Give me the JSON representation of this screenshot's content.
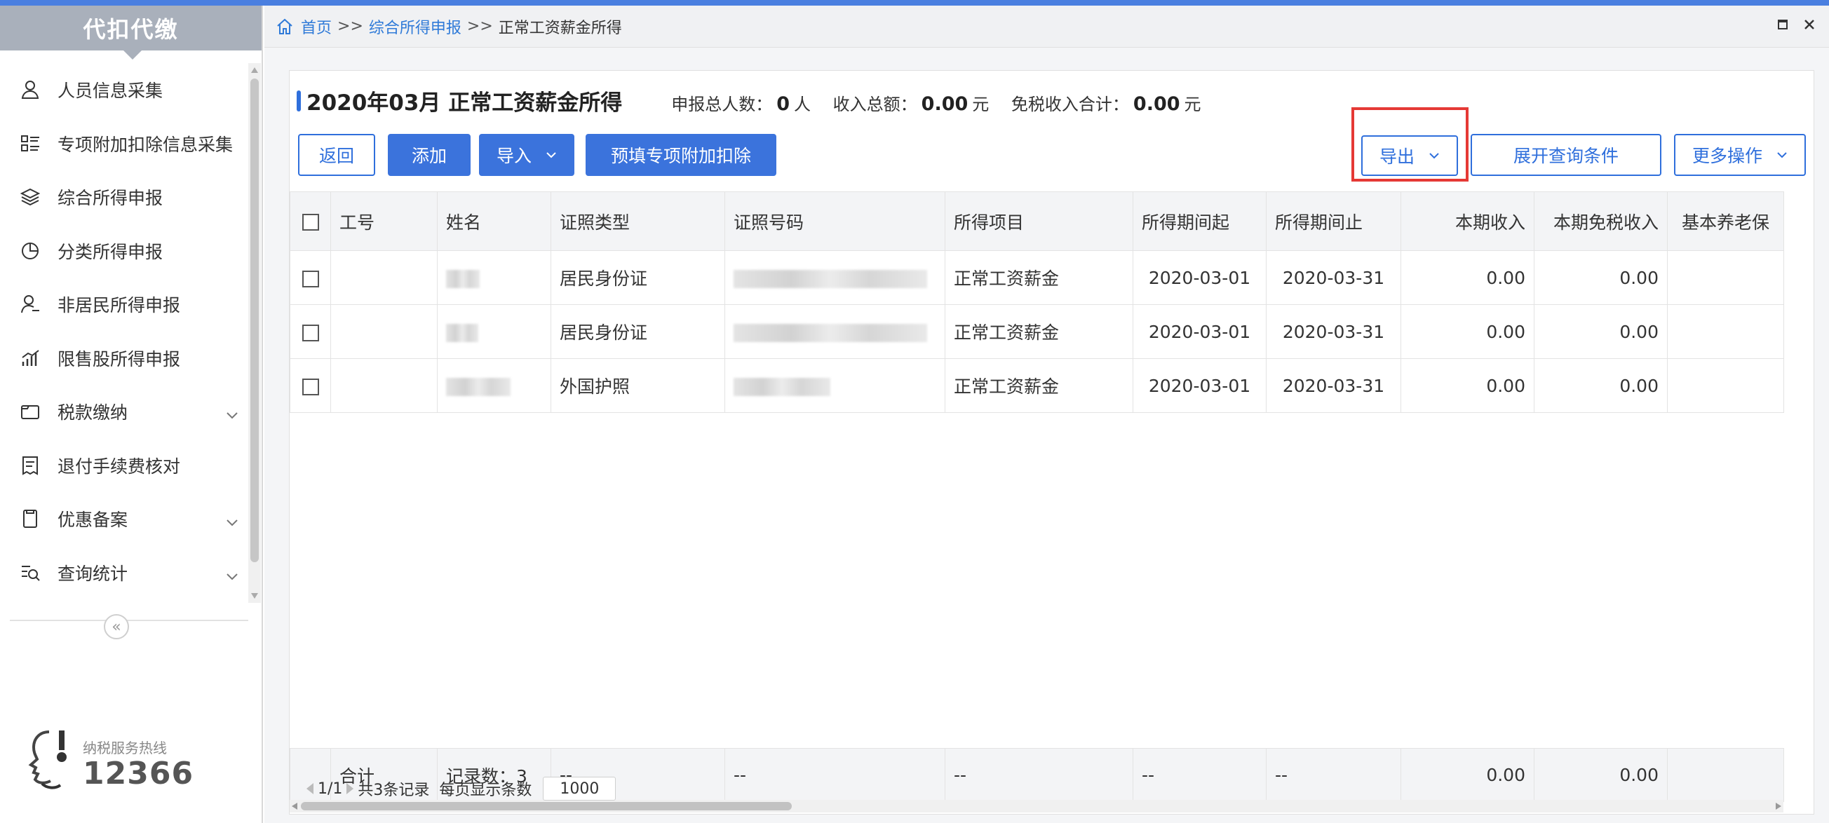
{
  "sidebar": {
    "title": "代扣代缴",
    "items": [
      {
        "label": "人员信息采集",
        "icon": "person-icon",
        "expandable": false
      },
      {
        "label": "专项附加扣除信息采集",
        "icon": "list-icon",
        "expandable": false
      },
      {
        "label": "综合所得申报",
        "icon": "layers-icon",
        "expandable": false
      },
      {
        "label": "分类所得申报",
        "icon": "pie-chart-icon",
        "expandable": false
      },
      {
        "label": "非居民所得申报",
        "icon": "person-outline-icon",
        "expandable": false
      },
      {
        "label": "限售股所得申报",
        "icon": "bar-chart-icon",
        "expandable": false
      },
      {
        "label": "税款缴纳",
        "icon": "wallet-icon",
        "expandable": true
      },
      {
        "label": "退付手续费核对",
        "icon": "receipt-icon",
        "expandable": false
      },
      {
        "label": "优惠备案",
        "icon": "document-icon",
        "expandable": true
      },
      {
        "label": "查询统计",
        "icon": "search-list-icon",
        "expandable": true
      }
    ],
    "collapse_label": "«",
    "hotline_label": "纳税服务热线",
    "hotline_number": "12366"
  },
  "breadcrumb": {
    "home": "首页",
    "sep": ">>",
    "level1": "综合所得申报",
    "current": "正常工资薪金所得"
  },
  "panel": {
    "title": "2020年03月 正常工资薪金所得",
    "summary": {
      "people_label": "申报总人数：",
      "people_value": "0",
      "people_unit": "人",
      "income_label": "收入总额：",
      "income_value": "0.00",
      "income_unit": "元",
      "taxfree_label": "免税收入合计：",
      "taxfree_value": "0.00",
      "taxfree_unit": "元"
    }
  },
  "toolbar": {
    "back": "返回",
    "add": "添加",
    "import": "导入",
    "prefill": "预填专项附加扣除",
    "export": "导出",
    "expand_query": "展开查询条件",
    "more": "更多操作"
  },
  "table": {
    "headers": [
      "工号",
      "姓名",
      "证照类型",
      "证照号码",
      "所得项目",
      "所得期间起",
      "所得期间止",
      "本期收入",
      "本期免税收入",
      "基本养老保"
    ],
    "rows": [
      {
        "emp_id": "",
        "id_type": "居民身份证",
        "income_item": "正常工资薪金",
        "start": "2020-03-01",
        "end": "2020-03-31",
        "income": "0.00",
        "taxfree": "0.00"
      },
      {
        "emp_id": "",
        "id_type": "居民身份证",
        "income_item": "正常工资薪金",
        "start": "2020-03-01",
        "end": "2020-03-31",
        "income": "0.00",
        "taxfree": "0.00"
      },
      {
        "emp_id": "",
        "id_type": "外国护照",
        "income_item": "正常工资薪金",
        "start": "2020-03-01",
        "end": "2020-03-31",
        "income": "0.00",
        "taxfree": "0.00"
      }
    ],
    "footer": {
      "total_label": "合计",
      "record_count": "记录数：3",
      "dash": "--",
      "income_total": "0.00",
      "taxfree_total": "0.00"
    }
  },
  "pager": {
    "page": "1/1",
    "total": "共3条记录",
    "per_page_label": "每页显示条数",
    "per_page": "1000"
  },
  "colors": {
    "accent": "#3b73dc",
    "link": "#2f7ad8",
    "highlight": "#e53935",
    "sidebar_header": "#a9b0bb"
  }
}
